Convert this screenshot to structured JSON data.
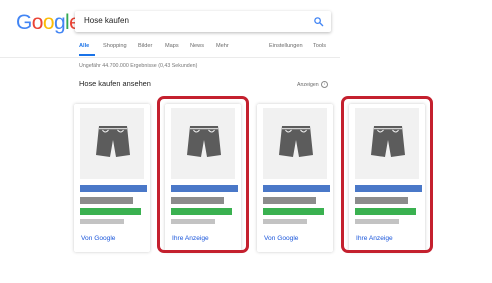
{
  "logo": {
    "text": "Google",
    "letters": [
      {
        "char": "G",
        "color": "#4285F4"
      },
      {
        "char": "o",
        "color": "#EA4335"
      },
      {
        "char": "o",
        "color": "#FBBC05"
      },
      {
        "char": "g",
        "color": "#4285F4"
      },
      {
        "char": "l",
        "color": "#34A853"
      },
      {
        "char": "e",
        "color": "#EA4335"
      }
    ]
  },
  "search": {
    "value": "Hose kaufen",
    "icon": "search-icon"
  },
  "tabs": {
    "all": "Alle",
    "shopping": "Shopping",
    "images": "Bilder",
    "maps": "Maps",
    "news": "News",
    "more": "Mehr",
    "settings": "Einstellungen",
    "tools": "Tools",
    "active": "Alle",
    "accent": "#1a73e8"
  },
  "results": {
    "stats": "Ungefähr 44.700.000 Ergebnisse (0,43 Sekunden)"
  },
  "shopping": {
    "title": "Hose kaufen ansehen",
    "ads_label": "Anzeigen",
    "ads_info_icon": "info-icon",
    "cards": [
      {
        "link": "Von Google",
        "icon": "shorts-icon",
        "highlighted": false
      },
      {
        "link": "Ihre Anzeige",
        "icon": "shorts-icon",
        "highlighted": true
      },
      {
        "link": "Von Google",
        "icon": "shorts-icon",
        "highlighted": false
      },
      {
        "link": "Ihre Anzeige",
        "icon": "shorts-icon",
        "highlighted": true
      }
    ]
  },
  "colors": {
    "highlight": "#c4202e",
    "bar_blue": "#4a78c8",
    "bar_gray": "#8c8c8c",
    "bar_green": "#3ab150",
    "bar_light": "#c3c3c3",
    "link": "#1a56db"
  }
}
